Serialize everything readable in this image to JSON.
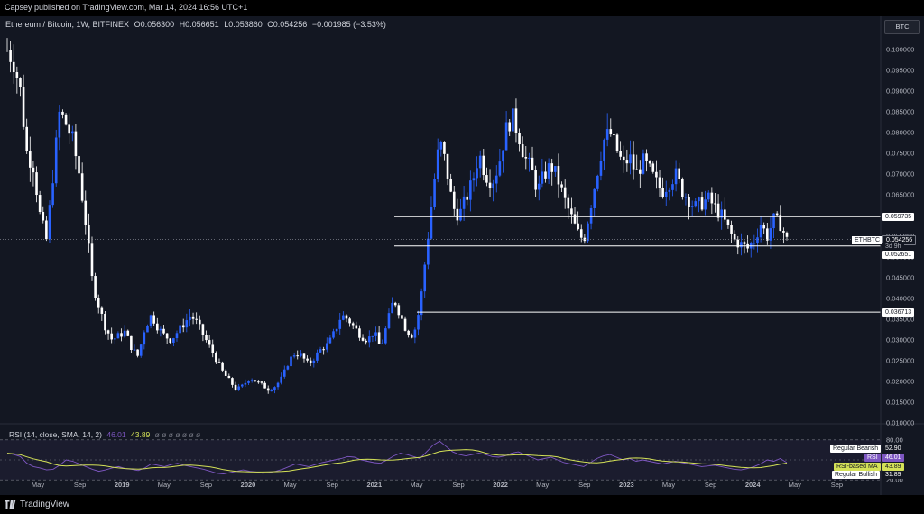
{
  "header": {
    "published": "Capsey published on TradingView.com, Mar 14, 2024 16:56 UTC+1"
  },
  "symbol": {
    "name": "Ethereum / Bitcoin, 1W, BITFINEX",
    "open": "O0.056300",
    "high": "H0.056651",
    "low": "L0.053860",
    "close": "C0.054256",
    "change": "−0.001985 (−3.53%)"
  },
  "currency_button": "BTC",
  "price_axis": {
    "ticks": [
      "0.100000",
      "0.095000",
      "0.090000",
      "0.085000",
      "0.080000",
      "0.075000",
      "0.070000",
      "0.065000",
      "0.060000",
      "0.055000",
      "0.050000",
      "0.045000",
      "0.040000",
      "0.035000",
      "0.030000",
      "0.025000",
      "0.020000",
      "0.015000",
      "0.010000"
    ]
  },
  "tags": {
    "level_top": "0.059735",
    "ticker": "ETHBTC",
    "price_current": "0.054256",
    "countdown": "3d 9h",
    "level_mid": "0.052651",
    "level_low": "0.036713"
  },
  "time_axis": {
    "labels": [
      "May",
      "Sep",
      "2019",
      "May",
      "Sep",
      "2020",
      "May",
      "Sep",
      "2021",
      "May",
      "Sep",
      "2022",
      "May",
      "Sep",
      "2023",
      "May",
      "Sep",
      "2024",
      "May",
      "Sep"
    ]
  },
  "rsi": {
    "title": "RSI (14, close, SMA, 14, 2)",
    "rsi_value": "46.01",
    "ma_value": "43.89",
    "placeholders": "ø ø ø ø ø ø ø",
    "axis_ticks": [
      "80.00",
      "20.00"
    ],
    "tags": {
      "regular_bearish_label": "Regular Bearish",
      "regular_bearish_value": "52.90",
      "rsi_label": "RSI",
      "rsi_value": "46.01",
      "ma_label": "RSI-based MA",
      "ma_value": "43.89",
      "regular_bullish_label": "Regular Bullish",
      "regular_bullish_value": "31.89"
    }
  },
  "footer": {
    "brand": "TradingView"
  },
  "colors": {
    "background": "#131722",
    "candle_up": "#2962ff",
    "candle_down": "#ffffff",
    "rsi_line": "#7e57c2",
    "rsi_ma": "#d4e157",
    "level_line": "#ffffff"
  },
  "chart_data": {
    "type": "candlestick",
    "title": "Ethereum / Bitcoin, 1W, BITFINEX",
    "ylim": [
      0.01,
      0.102
    ],
    "horizontal_levels": [
      0.059735,
      0.052651,
      0.036713
    ],
    "current_price": 0.054256,
    "close_path": [
      [
        0,
        0.1
      ],
      [
        1,
        0.097
      ],
      [
        2,
        0.09
      ],
      [
        3,
        0.075
      ],
      [
        4,
        0.072
      ],
      [
        5,
        0.06
      ],
      [
        6,
        0.054
      ],
      [
        7,
        0.07
      ],
      [
        8,
        0.085
      ],
      [
        9,
        0.082
      ],
      [
        10,
        0.078
      ],
      [
        11,
        0.07
      ],
      [
        12,
        0.058
      ],
      [
        13,
        0.044
      ],
      [
        14,
        0.038
      ],
      [
        15,
        0.033
      ],
      [
        16,
        0.03
      ],
      [
        17,
        0.031
      ],
      [
        18,
        0.032
      ],
      [
        19,
        0.028
      ],
      [
        20,
        0.026
      ],
      [
        21,
        0.033
      ],
      [
        22,
        0.036
      ],
      [
        23,
        0.033
      ],
      [
        24,
        0.031
      ],
      [
        25,
        0.03
      ],
      [
        26,
        0.032
      ],
      [
        27,
        0.034
      ],
      [
        28,
        0.036
      ],
      [
        29,
        0.034
      ],
      [
        30,
        0.031
      ],
      [
        31,
        0.028
      ],
      [
        32,
        0.025
      ],
      [
        33,
        0.022
      ],
      [
        34,
        0.02
      ],
      [
        35,
        0.018
      ],
      [
        36,
        0.019
      ],
      [
        37,
        0.021
      ],
      [
        38,
        0.02
      ],
      [
        39,
        0.019
      ],
      [
        40,
        0.018
      ],
      [
        41,
        0.019
      ],
      [
        42,
        0.021
      ],
      [
        43,
        0.025
      ],
      [
        44,
        0.027
      ],
      [
        45,
        0.026
      ],
      [
        46,
        0.024
      ],
      [
        47,
        0.026
      ],
      [
        48,
        0.028
      ],
      [
        49,
        0.029
      ],
      [
        50,
        0.032
      ],
      [
        51,
        0.036
      ],
      [
        52,
        0.035
      ],
      [
        53,
        0.033
      ],
      [
        54,
        0.031
      ],
      [
        55,
        0.03
      ],
      [
        56,
        0.032
      ],
      [
        57,
        0.028
      ],
      [
        58,
        0.034
      ],
      [
        59,
        0.04
      ],
      [
        60,
        0.036
      ],
      [
        61,
        0.032
      ],
      [
        62,
        0.031
      ],
      [
        63,
        0.038
      ],
      [
        64,
        0.052
      ],
      [
        65,
        0.066
      ],
      [
        66,
        0.078
      ],
      [
        67,
        0.072
      ],
      [
        68,
        0.062
      ],
      [
        69,
        0.06
      ],
      [
        70,
        0.064
      ],
      [
        71,
        0.068
      ],
      [
        72,
        0.075
      ],
      [
        73,
        0.07
      ],
      [
        74,
        0.068
      ],
      [
        75,
        0.072
      ],
      [
        76,
        0.08
      ],
      [
        77,
        0.084
      ],
      [
        78,
        0.08
      ],
      [
        79,
        0.074
      ],
      [
        80,
        0.071
      ],
      [
        81,
        0.066
      ],
      [
        82,
        0.07
      ],
      [
        83,
        0.072
      ],
      [
        84,
        0.069
      ],
      [
        85,
        0.064
      ],
      [
        86,
        0.06
      ],
      [
        87,
        0.056
      ],
      [
        88,
        0.054
      ],
      [
        89,
        0.062
      ],
      [
        90,
        0.07
      ],
      [
        91,
        0.078
      ],
      [
        92,
        0.08
      ],
      [
        93,
        0.076
      ],
      [
        94,
        0.072
      ],
      [
        95,
        0.074
      ],
      [
        96,
        0.07
      ],
      [
        97,
        0.073
      ],
      [
        98,
        0.071
      ],
      [
        99,
        0.068
      ],
      [
        100,
        0.066
      ],
      [
        101,
        0.068
      ],
      [
        102,
        0.07
      ],
      [
        103,
        0.066
      ],
      [
        104,
        0.064
      ],
      [
        105,
        0.062
      ],
      [
        106,
        0.063
      ],
      [
        107,
        0.064
      ],
      [
        108,
        0.062
      ],
      [
        109,
        0.06
      ],
      [
        110,
        0.057
      ],
      [
        111,
        0.054
      ],
      [
        112,
        0.053
      ],
      [
        113,
        0.052
      ],
      [
        114,
        0.054
      ],
      [
        115,
        0.058
      ],
      [
        116,
        0.055
      ],
      [
        117,
        0.059
      ],
      [
        118,
        0.058
      ],
      [
        119,
        0.054
      ]
    ],
    "rsi_series": {
      "name": "RSI",
      "values": [
        60,
        58,
        55,
        45,
        40,
        38,
        35,
        36,
        42,
        50,
        48,
        44,
        40,
        36,
        33,
        35,
        38,
        40,
        37,
        36,
        34,
        38,
        44,
        42,
        40,
        43,
        45,
        42,
        40,
        38,
        36,
        33,
        30,
        29,
        31,
        33,
        35,
        33,
        32,
        30,
        31,
        33,
        36,
        40,
        44,
        42,
        40,
        43,
        46,
        48,
        50,
        52,
        55,
        54,
        50,
        48,
        46,
        45,
        50,
        56,
        60,
        58,
        55,
        52,
        62,
        72,
        78,
        70,
        62,
        58,
        56,
        58,
        60,
        58,
        55,
        54,
        56,
        60,
        62,
        58,
        54,
        50,
        52,
        54,
        50,
        46,
        44,
        42,
        40,
        46,
        52,
        56,
        58,
        54,
        50,
        52,
        48,
        50,
        48,
        46,
        44,
        46,
        48,
        46,
        44,
        42,
        40,
        41,
        42,
        40,
        38,
        36,
        35,
        37,
        40,
        44,
        50,
        48,
        52,
        46
      ]
    }
  }
}
